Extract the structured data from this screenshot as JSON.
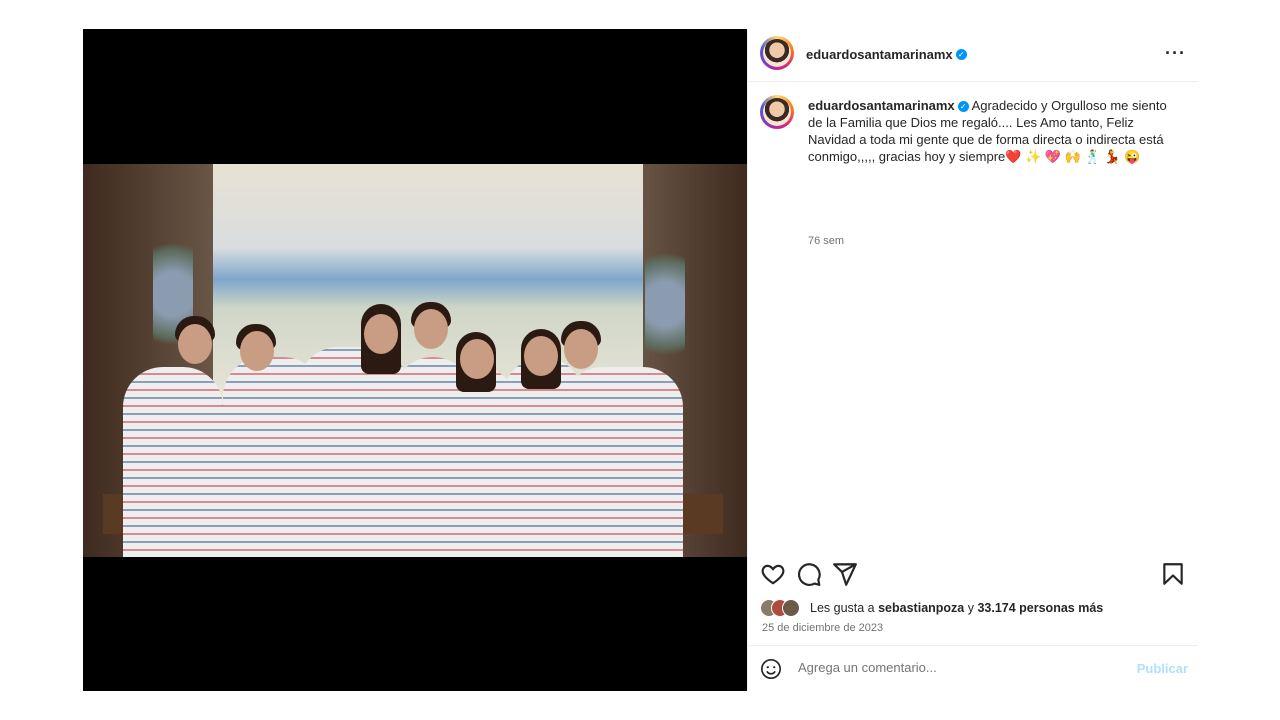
{
  "post": {
    "username": "eduardosantamarinamx",
    "caption": "Agradecido y Orgulloso me siento de la Familia que Dios me regaló.... Les Amo tanto, Feliz Navidad a toda mi gente que de forma directa o indirecta está conmigo,,,,, gracias hoy y siempre❤️ ✨ 💖 🙌 🕺 💃 😜",
    "time_ago": "76 sem",
    "likes_prefix": "Les gusta a ",
    "likes_user": "sebastianpoza",
    "likes_middle": " y ",
    "likes_count": "33.174 personas más",
    "date": "25 de diciembre de 2023",
    "comment_placeholder": "Agrega un comentario...",
    "publish_label": "Publicar"
  },
  "icons": {
    "more": "more-options-icon",
    "like": "heart-icon",
    "comment": "comment-icon",
    "share": "share-icon",
    "save": "bookmark-icon",
    "emoji": "emoji-icon",
    "verified": "verified-badge-icon"
  },
  "colors": {
    "verified": "#0095f6",
    "publish": "#b2dffc",
    "muted": "#737373"
  }
}
